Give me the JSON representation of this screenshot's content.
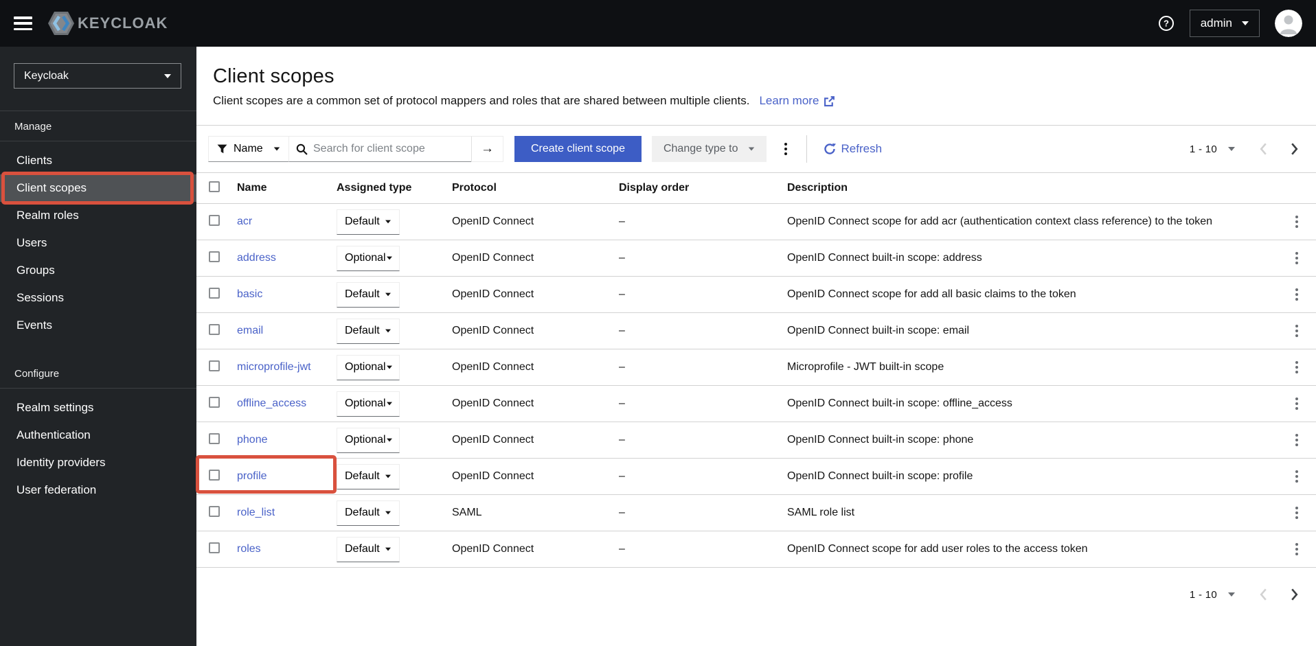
{
  "masthead": {
    "brand": "KEYCLOAK",
    "user": "admin"
  },
  "sidebar": {
    "realm_selector": "Keycloak",
    "sections": [
      {
        "title": "Manage",
        "items": [
          {
            "label": "Clients",
            "selected": false
          },
          {
            "label": "Client scopes",
            "selected": true
          },
          {
            "label": "Realm roles",
            "selected": false
          },
          {
            "label": "Users",
            "selected": false
          },
          {
            "label": "Groups",
            "selected": false
          },
          {
            "label": "Sessions",
            "selected": false
          },
          {
            "label": "Events",
            "selected": false
          }
        ]
      },
      {
        "title": "Configure",
        "items": [
          {
            "label": "Realm settings",
            "selected": false
          },
          {
            "label": "Authentication",
            "selected": false
          },
          {
            "label": "Identity providers",
            "selected": false
          },
          {
            "label": "User federation",
            "selected": false
          }
        ]
      }
    ]
  },
  "page": {
    "title": "Client scopes",
    "description": "Client scopes are a common set of protocol mappers and roles that are shared between multiple clients.",
    "learn_more": "Learn more"
  },
  "toolbar": {
    "filter_label": "Name",
    "search_placeholder": "Search for client scope",
    "create_button": "Create client scope",
    "change_type_label": "Change type to",
    "refresh_label": "Refresh",
    "pagination_range": "1 - 10"
  },
  "table": {
    "headers": [
      "Name",
      "Assigned type",
      "Protocol",
      "Display order",
      "Description"
    ],
    "rows": [
      {
        "name": "acr",
        "type": "Default",
        "protocol": "OpenID Connect",
        "display_order": "–",
        "description": "OpenID Connect scope for add acr (authentication context class reference) to the token",
        "highlighted": false
      },
      {
        "name": "address",
        "type": "Optional",
        "protocol": "OpenID Connect",
        "display_order": "–",
        "description": "OpenID Connect built-in scope: address",
        "highlighted": false
      },
      {
        "name": "basic",
        "type": "Default",
        "protocol": "OpenID Connect",
        "display_order": "–",
        "description": "OpenID Connect scope for add all basic claims to the token",
        "highlighted": false
      },
      {
        "name": "email",
        "type": "Default",
        "protocol": "OpenID Connect",
        "display_order": "–",
        "description": "OpenID Connect built-in scope: email",
        "highlighted": false
      },
      {
        "name": "microprofile-jwt",
        "type": "Optional",
        "protocol": "OpenID Connect",
        "display_order": "–",
        "description": "Microprofile - JWT built-in scope",
        "highlighted": false
      },
      {
        "name": "offline_access",
        "type": "Optional",
        "protocol": "OpenID Connect",
        "display_order": "–",
        "description": "OpenID Connect built-in scope: offline_access",
        "highlighted": false
      },
      {
        "name": "phone",
        "type": "Optional",
        "protocol": "OpenID Connect",
        "display_order": "–",
        "description": "OpenID Connect built-in scope: phone",
        "highlighted": false
      },
      {
        "name": "profile",
        "type": "Default",
        "protocol": "OpenID Connect",
        "display_order": "–",
        "description": "OpenID Connect built-in scope: profile",
        "highlighted": true
      },
      {
        "name": "role_list",
        "type": "Default",
        "protocol": "SAML",
        "display_order": "–",
        "description": "SAML role list",
        "highlighted": false
      },
      {
        "name": "roles",
        "type": "Default",
        "protocol": "OpenID Connect",
        "display_order": "–",
        "description": "OpenID Connect scope for add user roles to the access token",
        "highlighted": false
      }
    ],
    "pagination_range": "1 - 10"
  },
  "colors": {
    "accent_button": "#3d5dc5",
    "link": "#4a62c8",
    "annotation_red": "#d9513e",
    "masthead_bg": "#0e1013",
    "sidebar_bg": "#212427",
    "nav_selected_bg": "#4f5255"
  }
}
